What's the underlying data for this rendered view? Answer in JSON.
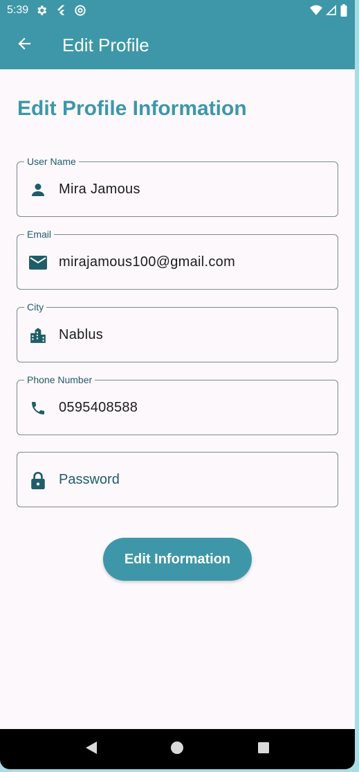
{
  "status_bar": {
    "time": "5:39",
    "left_icons": [
      "gear-icon",
      "flutter-icon",
      "at-icon"
    ],
    "right_icons": [
      "wifi-icon",
      "signal-icon",
      "battery-icon"
    ]
  },
  "app_bar": {
    "title": "Edit Profile",
    "back_icon": "arrow-left-icon"
  },
  "heading": "Edit Profile Information",
  "fields": [
    {
      "label": "User Name",
      "value": "Mira Jamous",
      "icon": "person-icon"
    },
    {
      "label": "Email",
      "value": "mirajamous100@gmail.com",
      "icon": "mail-icon"
    },
    {
      "label": "City",
      "value": "Nablus",
      "icon": "city-icon"
    },
    {
      "label": "Phone Number",
      "value": "0595408588",
      "icon": "phone-icon"
    },
    {
      "label": "",
      "value": "",
      "placeholder": "Password",
      "icon": "lock-icon"
    }
  ],
  "button": {
    "label": "Edit Information"
  },
  "nav_bar": {
    "icons": [
      "back-triangle-icon",
      "home-circle-icon",
      "recents-square-icon"
    ]
  },
  "colors": {
    "primary": "#3d97a8",
    "icon": "#1f5d68",
    "background": "#fdf8fc",
    "outline": "#7c8790"
  }
}
